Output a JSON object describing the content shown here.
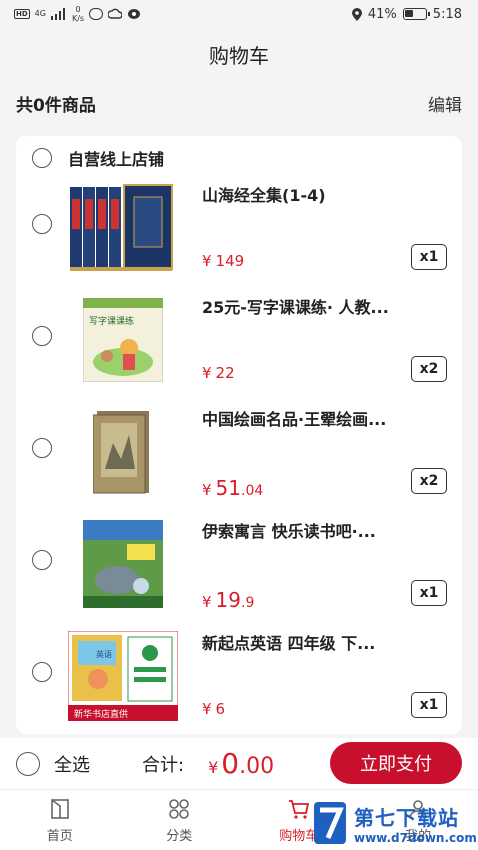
{
  "status_bar": {
    "hd": "HD",
    "network": "4G",
    "speed_value": "0",
    "speed_unit": "K/s",
    "battery_percent": "41%",
    "battery_level": 0.41,
    "time": "5:18"
  },
  "header": {
    "title": "购物车"
  },
  "summary": {
    "count_text": "共0件商品",
    "edit_label": "编辑"
  },
  "shop": {
    "name": "自营线上店铺"
  },
  "items": [
    {
      "title": "山海经全集(1-4)",
      "currency": "¥",
      "price_int": "149",
      "price_dec": "",
      "qty": "x1"
    },
    {
      "title": "25元-写字课课练· 人教...",
      "currency": "¥",
      "price_int": "22",
      "price_dec": "",
      "qty": "x2"
    },
    {
      "title": "中国绘画名品·王翚绘画...",
      "currency": "¥",
      "price_int": "51",
      "price_dec": ".04",
      "qty": "x2"
    },
    {
      "title": "伊索寓言 快乐读书吧·...",
      "currency": "¥",
      "price_int": "19",
      "price_dec": ".9",
      "qty": "x1"
    },
    {
      "title": "新起点英语 四年级 下...",
      "currency": "¥",
      "price_int": "6",
      "price_dec": "",
      "qty": "x1"
    }
  ],
  "pay_bar": {
    "select_all": "全选",
    "total_label": "合计:",
    "currency": "¥",
    "total_int": "0",
    "total_dec": ".00",
    "pay_button": "立即支付"
  },
  "tabs": [
    {
      "label": "首页",
      "icon": "book-icon"
    },
    {
      "label": "分类",
      "icon": "grid-icon"
    },
    {
      "label": "购物车",
      "icon": "cart-icon"
    },
    {
      "label": "我的",
      "icon": "user-icon"
    }
  ],
  "book_art": {
    "item2_cover_title": "写字课课练",
    "item5_brand": "新华书店直供",
    "item5_tag": "英语"
  },
  "watermark": {
    "name": "第七下载站",
    "url": "www.d7down.com"
  },
  "colors": {
    "accent": "#c8102e",
    "price": "#d81e2a",
    "watermark": "#1f5fbf"
  }
}
